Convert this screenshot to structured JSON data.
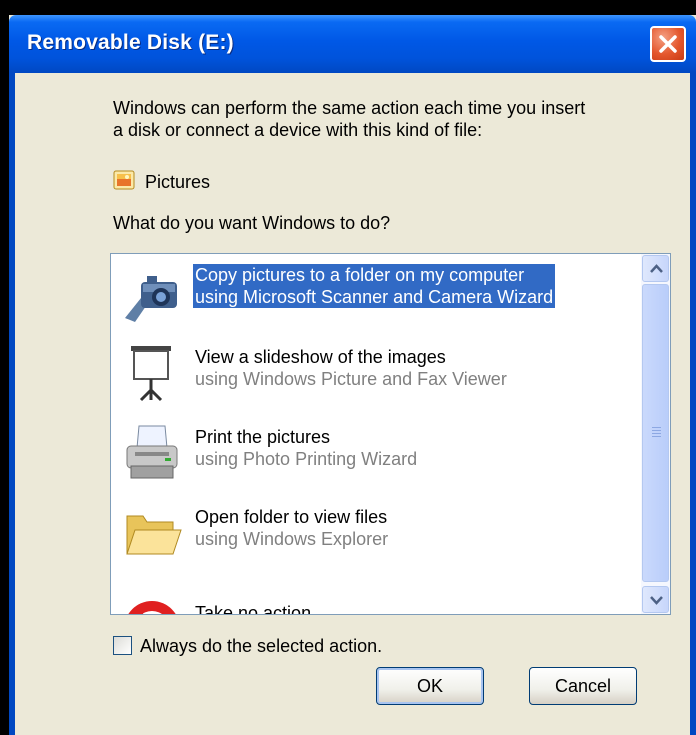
{
  "window": {
    "title": "Removable Disk (E:)"
  },
  "dialog": {
    "intro_line1": "Windows can perform the same action each time you insert",
    "intro_line2": "a disk or connect a device with this kind of file:",
    "content_type": "Pictures",
    "content_type_icon": "pictures-icon",
    "question": "What do you want Windows to do?"
  },
  "actions": [
    {
      "title": "Copy pictures to a folder on my computer",
      "subtitle": "using Microsoft Scanner and Camera Wizard",
      "icon": "camera-icon",
      "selected": true
    },
    {
      "title": "View a slideshow of the images",
      "subtitle": "using Windows Picture and Fax Viewer",
      "icon": "projector-screen-icon",
      "selected": false
    },
    {
      "title": "Print the pictures",
      "subtitle": "using Photo Printing Wizard",
      "icon": "printer-icon",
      "selected": false
    },
    {
      "title": "Open folder to view files",
      "subtitle": "using Windows Explorer",
      "icon": "folder-icon",
      "selected": false
    },
    {
      "title": "Take no action",
      "subtitle": "",
      "icon": "no-action-icon",
      "selected": false
    }
  ],
  "options": {
    "always_label": "Always do the selected action.",
    "always_checked": false
  },
  "buttons": {
    "ok": "OK",
    "cancel": "Cancel"
  },
  "colors": {
    "selection": "#316ac5",
    "title_bar": "#0058e6",
    "dialog_bg": "#ece9d8",
    "close_button": "#e4572d"
  }
}
